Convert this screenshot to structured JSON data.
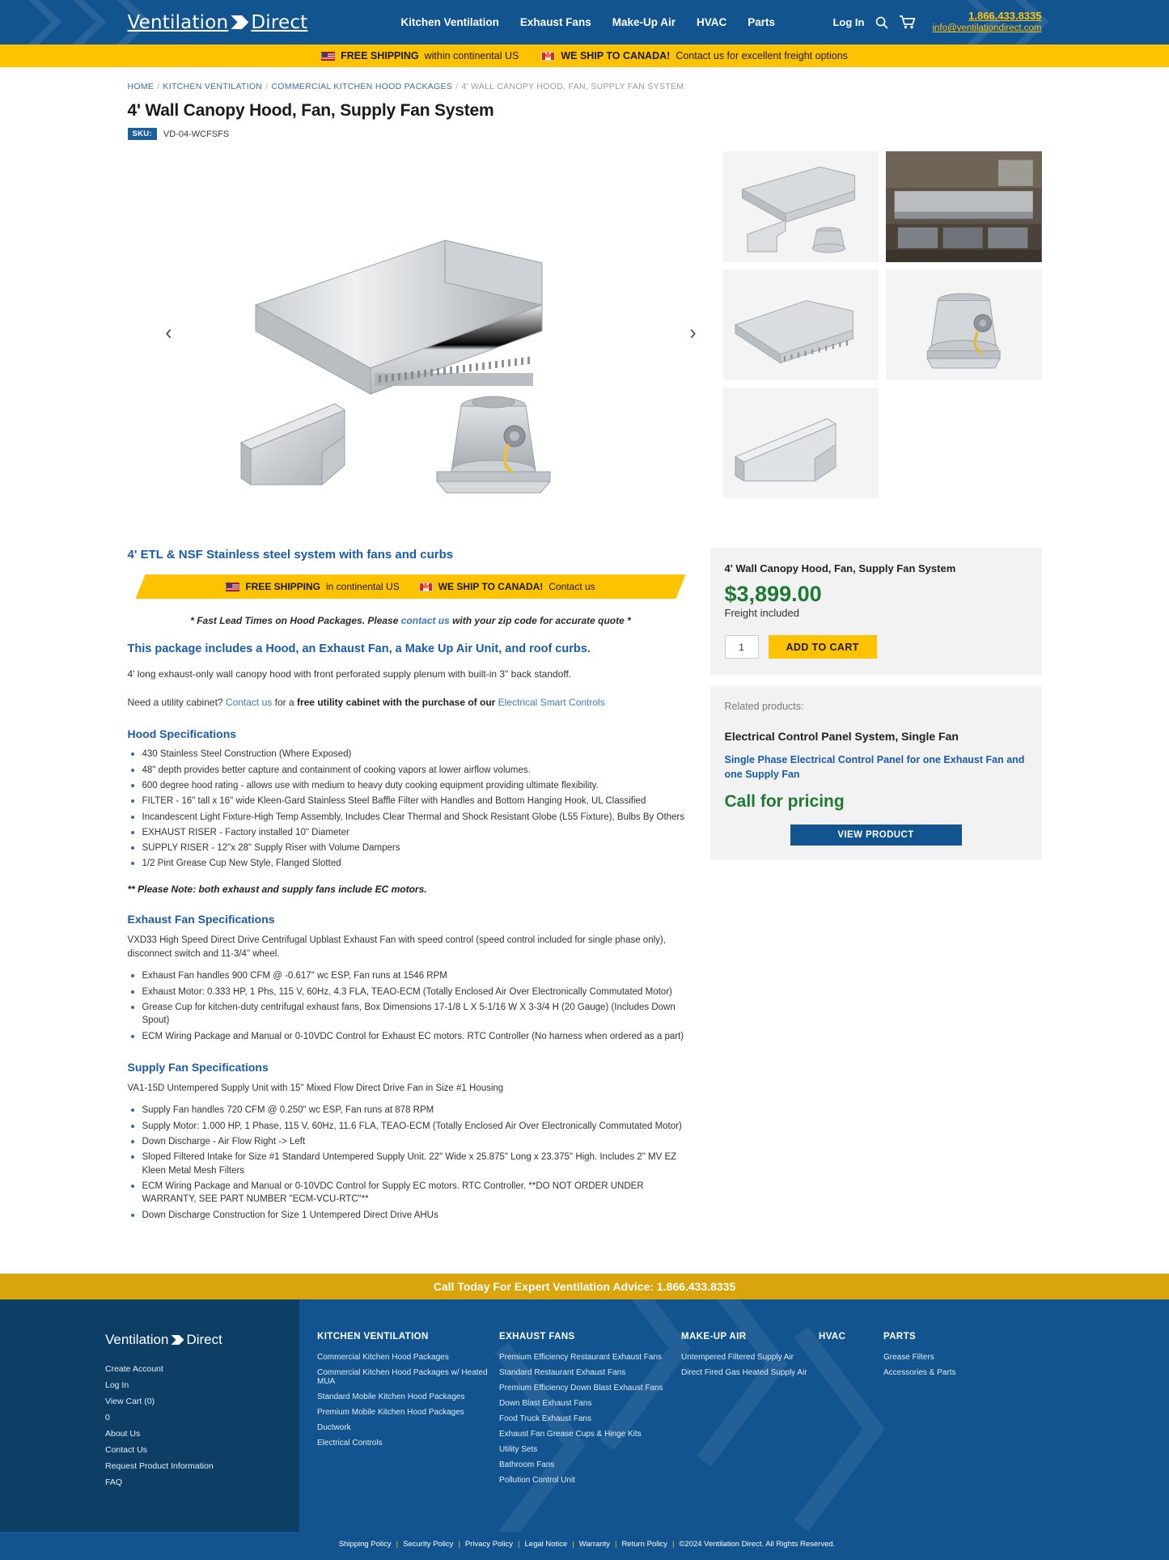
{
  "header": {
    "logo_text_left": "Ventilation",
    "logo_text_right": "Direct",
    "nav": [
      {
        "label": "Kitchen Ventilation"
      },
      {
        "label": "Exhaust Fans"
      },
      {
        "label": "Make-Up Air"
      },
      {
        "label": "HVAC"
      },
      {
        "label": "Parts"
      }
    ],
    "login_label": "Log In",
    "search_icon": "search-icon",
    "cart_icon": "cart-icon",
    "phone": "1.866.433.8335",
    "email": "info@ventilationdirect.com"
  },
  "ship_bar": {
    "us_bold": "FREE SHIPPING",
    "us_rest": "within continental US",
    "ca_bold": "WE SHIP TO CANADA!",
    "ca_rest": "Contact us for excellent freight options"
  },
  "breadcrumb": {
    "items": [
      {
        "label": "HOME"
      },
      {
        "label": "KITCHEN VENTILATION"
      },
      {
        "label": "COMMERCIAL KITCHEN HOOD PACKAGES"
      }
    ],
    "current": "4' WALL CANOPY HOOD, FAN, SUPPLY FAN SYSTEM"
  },
  "product": {
    "title": "4' Wall Canopy Hood, Fan, Supply Fan System",
    "sku_label": "SKU:",
    "sku_value": "VD-04-WCFSFS",
    "prev_arrow": "‹",
    "next_arrow": "›"
  },
  "description": {
    "heading": "4' ETL & NSF Stainless steel system with fans and curbs",
    "ribbon": {
      "us_bold": "FREE SHIPPING",
      "us_rest": "in continental US",
      "ca_bold": "WE SHIP TO CANADA!",
      "ca_rest": "Contact us"
    },
    "lead_note_a": "* Fast Lead Times on Hood Packages.  Please ",
    "lead_note_link": "contact us",
    "lead_note_b": " with your zip code for accurate quote *",
    "includes_heading": "This package includes a Hood, an Exhaust Fan, a Make Up Air Unit, and roof curbs.",
    "para_1": "4' long exhaust-only wall canopy hood with front perforated supply plenum with built-in 3\" back standoff.",
    "utility_a": "Need a utility cabinet? ",
    "utility_link1": "Contact us",
    "utility_b": " for a ",
    "utility_bold": "free utility cabinet with the purchase of our ",
    "utility_link2": "Electrical Smart Controls"
  },
  "hood_specs": {
    "heading": "Hood Specifications",
    "items": [
      "430 Stainless Steel Construction (Where Exposed)",
      "48\" depth provides better capture and containment of cooking vapors at lower airflow volumes.",
      "600 degree hood rating - allows use with medium to heavy duty cooking equipment providing ultimate flexibility.",
      "FILTER - 16\" tall x 16\" wide Kleen-Gard Stainless Steel Baffle Filter with Handles and Bottom Hanging Hook, UL Classified",
      "Incandescent Light Fixture-High Temp Assembly, Includes Clear Thermal and Shock Resistant Globe (L55 Fixture), Bulbs By Others",
      "EXHAUST RISER - Factory installed 10\" Diameter",
      "SUPPLY RISER - 12\"x 28\" Supply Riser with Volume Dampers",
      "1/2 Pint Grease Cup New Style, Flanged Slotted"
    ],
    "note": "** Please Note: both exhaust and supply fans include EC motors."
  },
  "exhaust_specs": {
    "heading": "Exhaust Fan Specifications",
    "intro": "VXD33 High Speed Direct Drive Centrifugal Upblast Exhaust Fan with speed control (speed control included for single phase only), disconnect switch and 11-3/4\" wheel.",
    "items": [
      "Exhaust Fan handles 900 CFM @ -0.617\" wc ESP, Fan runs at 1546 RPM",
      "Exhaust Motor: 0.333 HP, 1 Phs, 115 V, 60Hz, 4.3 FLA, TEAO-ECM (Totally Enclosed Air Over Electronically Commutated Motor)",
      "Grease Cup for kitchen-duty centrifugal exhaust fans, Box Dimensions 17-1/8 L X 5-1/16 W X 3-3/4 H (20 Gauge) (Includes Down Spout)",
      "ECM Wiring Package and Manual or 0-10VDC Control for Exhaust EC motors. RTC Controller (No harness when ordered as a part)"
    ]
  },
  "supply_specs": {
    "heading": "Supply Fan Specifications",
    "intro": "VA1-15D Untempered Supply Unit with 15\" Mixed Flow Direct Drive Fan in Size #1 Housing",
    "items": [
      "Supply Fan handles 720 CFM @ 0.250\" wc ESP, Fan runs at 878 RPM",
      "Supply Motor: 1.000 HP, 1 Phase, 115 V, 60Hz, 11.6 FLA, TEAO-ECM (Totally Enclosed Air Over Electronically Commutated Motor)",
      "Down Discharge - Air Flow Right -> Left",
      "Sloped Filtered Intake for Size #1 Standard Untempered Supply Unit.  22\" Wide x 25.875\" Long x 23.375\" High.  Includes 2\" MV EZ Kleen Metal Mesh Filters",
      "ECM Wiring Package and Manual or 0-10VDC Control for Supply EC motors. RTC Controller. **DO NOT ORDER UNDER WARRANTY, SEE PART NUMBER \"ECM-VCU-RTC\"**",
      "Down Discharge Construction for Size 1 Untempered Direct Drive AHUs"
    ]
  },
  "buybox": {
    "title": "4' Wall Canopy Hood, Fan, Supply Fan System",
    "price": "$3,899.00",
    "freight": "Freight included",
    "qty_value": "1",
    "add_to_cart": "ADD TO CART"
  },
  "related": {
    "label": "Related products:",
    "title": "Electrical Control Panel System, Single Fan",
    "subtitle": "Single Phase Electrical Control Panel for one Exhaust Fan and one Supply Fan",
    "price": "Call for pricing",
    "button": "VIEW PRODUCT"
  },
  "call_bar": {
    "text": "Call Today For Expert Ventilation Advice: 1.866.433.8335"
  },
  "footer": {
    "logo_text_left": "Ventilation",
    "logo_text_right": "Direct",
    "account_links": [
      {
        "label": "Create Account"
      },
      {
        "label": "Log In"
      },
      {
        "label": "View Cart (0)"
      },
      {
        "label": "0"
      },
      {
        "label": "About Us"
      },
      {
        "label": "Contact Us"
      },
      {
        "label": "Request Product Information"
      },
      {
        "label": "FAQ"
      }
    ],
    "columns": [
      {
        "heading": "KITCHEN VENTILATION",
        "links": [
          {
            "label": "Commercial Kitchen Hood Packages"
          },
          {
            "label": "Commercial Kitchen Hood Packages w/ Heated MUA"
          },
          {
            "label": "Standard Mobile Kitchen Hood Packages"
          },
          {
            "label": "Premium Mobile Kitchen Hood Packages"
          },
          {
            "label": "Ductwork"
          },
          {
            "label": "Electrical Controls"
          }
        ]
      },
      {
        "heading": "EXHAUST FANS",
        "links": [
          {
            "label": "Premium Efficiency Restaurant Exhaust Fans"
          },
          {
            "label": "Standard Restaurant Exhaust Fans"
          },
          {
            "label": "Premium Efficiency Down Blast Exhaust Fans"
          },
          {
            "label": "Down Blast Exhaust Fans"
          },
          {
            "label": "Food Truck Exhaust Fans"
          },
          {
            "label": "Exhaust Fan Grease Cups & Hinge Kits"
          },
          {
            "label": "Utility Sets"
          },
          {
            "label": "Bathroom Fans"
          },
          {
            "label": "Pollution Control Unit"
          }
        ]
      },
      {
        "heading": "MAKE-UP AIR",
        "links": [
          {
            "label": "Untempered Filtered Supply Air"
          },
          {
            "label": "Direct Fired Gas Heated Supply Air"
          }
        ]
      },
      {
        "heading": "HVAC",
        "links": []
      },
      {
        "heading": "PARTS",
        "links": [
          {
            "label": "Grease Filters"
          },
          {
            "label": "Accessories & Parts"
          }
        ]
      }
    ],
    "legal_links": [
      {
        "label": "Shipping Policy"
      },
      {
        "label": "Security Policy"
      },
      {
        "label": "Privacy Policy"
      },
      {
        "label": "Legal Notice"
      },
      {
        "label": "Warranty"
      },
      {
        "label": "Return Policy"
      }
    ],
    "copyright": "©2024 Ventilation Direct. All Rights Reserved."
  },
  "colors": {
    "brand_blue": "#12548f",
    "dark_blue": "#0d3f66",
    "yellow": "#fdc300",
    "gold": "#d9a40c",
    "green": "#1e7a33",
    "link_blue": "#1a5ca8"
  }
}
